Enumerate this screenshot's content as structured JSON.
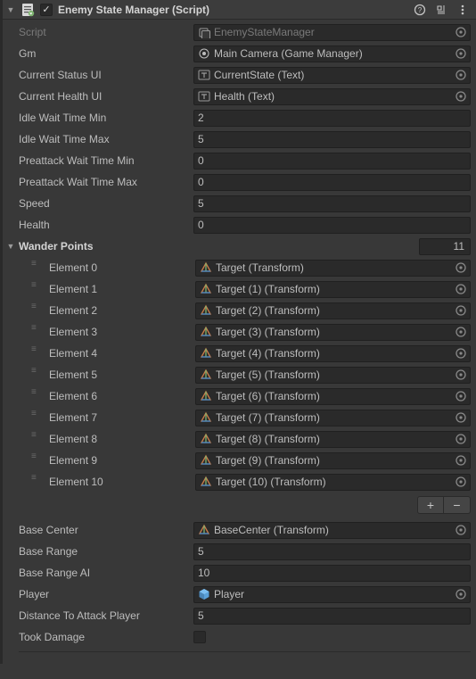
{
  "header": {
    "title": "Enemy State Manager (Script)",
    "enabled": true
  },
  "fields": {
    "script": {
      "label": "Script",
      "value": "EnemyStateManager"
    },
    "gm": {
      "label": "Gm",
      "value": "Main Camera (Game Manager)"
    },
    "currentStatusUI": {
      "label": "Current Status UI",
      "value": "CurrentState (Text)"
    },
    "currentHealthUI": {
      "label": "Current Health UI",
      "value": "Health (Text)"
    },
    "idleWaitTimeMin": {
      "label": "Idle Wait Time Min",
      "value": "2"
    },
    "idleWaitTimeMax": {
      "label": "Idle Wait Time Max",
      "value": "5"
    },
    "preattackWaitTimeMin": {
      "label": "Preattack Wait Time Min",
      "value": "0"
    },
    "preattackWaitTimeMax": {
      "label": "Preattack Wait Time Max",
      "value": "0"
    },
    "speed": {
      "label": "Speed",
      "value": "5"
    },
    "health": {
      "label": "Health",
      "value": "0"
    },
    "baseCenter": {
      "label": "Base Center",
      "value": "BaseCenter (Transform)"
    },
    "baseRange": {
      "label": "Base Range",
      "value": "5"
    },
    "baseRangeAI": {
      "label": "Base Range AI",
      "value": "10"
    },
    "player": {
      "label": "Player",
      "value": "Player"
    },
    "distanceToAttackPlayer": {
      "label": "Distance To Attack Player",
      "value": "5"
    },
    "tookDamage": {
      "label": "Took Damage",
      "value": false
    }
  },
  "wanderPoints": {
    "label": "Wander Points",
    "count": "11",
    "elements": [
      {
        "label": "Element 0",
        "value": "Target (Transform)"
      },
      {
        "label": "Element 1",
        "value": "Target (1) (Transform)"
      },
      {
        "label": "Element 2",
        "value": "Target (2) (Transform)"
      },
      {
        "label": "Element 3",
        "value": "Target (3) (Transform)"
      },
      {
        "label": "Element 4",
        "value": "Target (4) (Transform)"
      },
      {
        "label": "Element 5",
        "value": "Target (5) (Transform)"
      },
      {
        "label": "Element 6",
        "value": "Target (6) (Transform)"
      },
      {
        "label": "Element 7",
        "value": "Target (7) (Transform)"
      },
      {
        "label": "Element 8",
        "value": "Target (8) (Transform)"
      },
      {
        "label": "Element 9",
        "value": "Target (9) (Transform)"
      },
      {
        "label": "Element 10",
        "value": "Target (10) (Transform)"
      }
    ]
  }
}
